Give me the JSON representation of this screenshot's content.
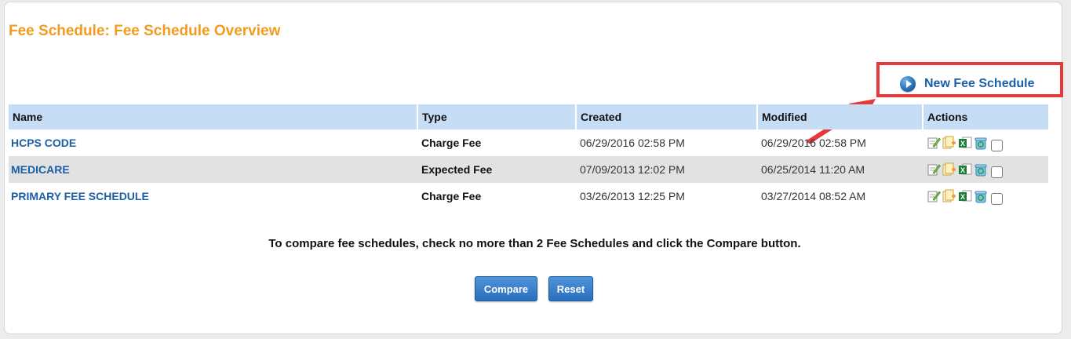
{
  "page": {
    "title": "Fee Schedule: Fee Schedule Overview"
  },
  "new_link": {
    "label": "New Fee Schedule",
    "icon": "play-circle-icon"
  },
  "table": {
    "columns": [
      "Name",
      "Type",
      "Created",
      "Modified",
      "Actions"
    ],
    "rows": [
      {
        "name": "HCPS CODE",
        "type": "Charge Fee",
        "created": "06/29/2016 02:58 PM",
        "modified": "06/29/2016 02:58 PM"
      },
      {
        "name": "MEDICARE",
        "type": "Expected Fee",
        "created": "07/09/2013 12:02 PM",
        "modified": "06/25/2014 11:20 AM"
      },
      {
        "name": "PRIMARY FEE SCHEDULE",
        "type": "Charge Fee",
        "created": "03/26/2013 12:25 PM",
        "modified": "03/27/2014 08:52 AM"
      }
    ],
    "action_icons": [
      "edit-icon",
      "copy-icon",
      "excel-export-icon",
      "delete-icon"
    ]
  },
  "hint": "To compare fee schedules, check no more than 2 Fee Schedules and click the Compare button.",
  "buttons": {
    "compare": "Compare",
    "reset": "Reset"
  },
  "colors": {
    "title": "#f39b1f",
    "link": "#1a5fa8",
    "header_bg": "#c5ddf5",
    "highlight": "#e7383b",
    "button": "#2a6fbd"
  }
}
